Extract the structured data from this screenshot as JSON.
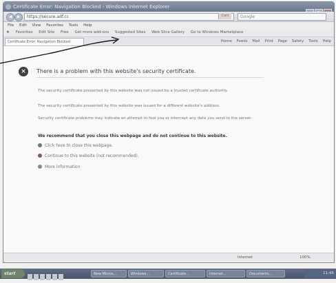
{
  "window": {
    "title": "Certificate Error: Navigation Blocked - Windows Internet Explorer",
    "buttons": [
      "_",
      "□",
      "×"
    ]
  },
  "addressbar": {
    "url": "https://secure.adf.cc",
    "cert_error_label": "Cert",
    "search_placeholder": "Google"
  },
  "menubar": {
    "items": [
      "File",
      "Edit",
      "View",
      "Favorites",
      "Tools",
      "Help"
    ]
  },
  "favbar": {
    "items": [
      "Favorites",
      "Edit Site",
      "Free",
      "Get more add-ons",
      "Suggested Sites",
      "Web Slice Gallery",
      "Go to Windows Marketplace"
    ]
  },
  "tab": {
    "label": "Certificate Error: Navigation Blocked"
  },
  "commandbar": {
    "items": [
      "Home",
      "Feeds",
      "Mail",
      "Print",
      "Page",
      "Safety",
      "Tools",
      "Help"
    ]
  },
  "content": {
    "heading": "There is a problem with this website's security certificate.",
    "paragraph1": "The security certificate presented by this website was not issued by a trusted certificate authority.",
    "paragraph2": "The security certificate presented by this website was issued for a different website's address.",
    "paragraph3": "Security certificate problems may indicate an attempt to fool you or intercept any data you send to the server.",
    "recommendation": "We recommend that you close this webpage and do not continue to this website.",
    "option_close": "Click here to close this webpage.",
    "option_continue": "Continue to this website (not recommended).",
    "option_more": "More information"
  },
  "statusbar": {
    "zone": "Internet",
    "zoom": "100%"
  },
  "taskbar": {
    "start_label": "start",
    "tasks": [
      "New Micros...",
      "Windows...",
      "Certificate...",
      "Internet...",
      "Documents..."
    ],
    "clock": "11:45"
  }
}
